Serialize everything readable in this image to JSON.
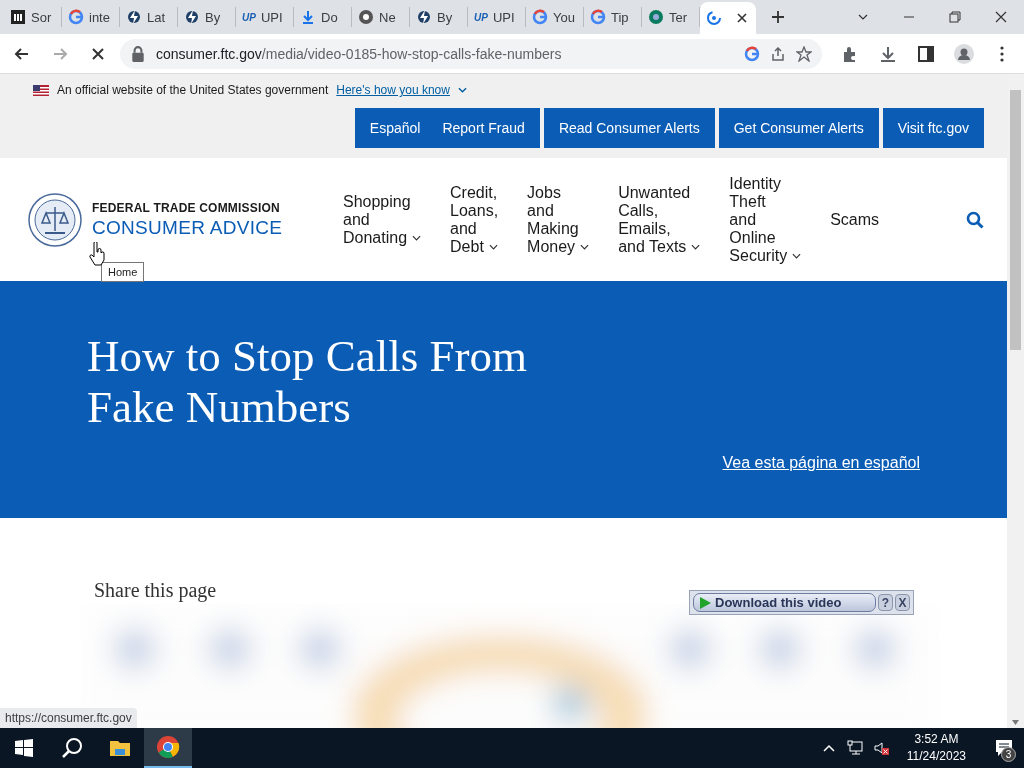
{
  "browser": {
    "tabs": [
      {
        "title": "Sor",
        "kind": "museum",
        "selected": false
      },
      {
        "title": "inte",
        "kind": "google",
        "selected": false
      },
      {
        "title": "Lat",
        "kind": "bolt",
        "selected": false
      },
      {
        "title": "By",
        "kind": "bolt",
        "selected": false
      },
      {
        "title": "UPI",
        "kind": "lettermark",
        "icon_text": "UP",
        "selected": false
      },
      {
        "title": "Do",
        "kind": "download",
        "selected": false
      },
      {
        "title": "Ne",
        "kind": "chrome",
        "selected": false
      },
      {
        "title": "By",
        "kind": "bolt",
        "selected": false
      },
      {
        "title": "UPI",
        "kind": "lettermark",
        "icon_text": "UP",
        "selected": false
      },
      {
        "title": "You",
        "kind": "google",
        "selected": false
      },
      {
        "title": "Tip",
        "kind": "google",
        "selected": false
      },
      {
        "title": "Ter",
        "kind": "globe",
        "selected": false
      },
      {
        "kind": "spinner",
        "selected": true
      }
    ],
    "address": {
      "domain": "consumer.ftc.gov",
      "path": "/media/video-0185-how-stop-calls-fake-numbers",
      "loading": true
    }
  },
  "gov_banner": {
    "text": "An official website of the United States government",
    "link": "Here's how you know"
  },
  "utility_nav": [
    {
      "items": [
        "Español",
        "Report Fraud"
      ]
    },
    {
      "items": [
        "Read Consumer Alerts"
      ]
    },
    {
      "items": [
        "Get Consumer Alerts"
      ]
    },
    {
      "items": [
        "Visit ftc.gov"
      ]
    }
  ],
  "logo": {
    "agency": "FEDERAL TRADE COMMISSION",
    "site": "CONSUMER ADVICE"
  },
  "main_nav": [
    {
      "label": "Shopping\nand\nDonating",
      "dropdown": true
    },
    {
      "label": "Credit,\nLoans,\nand\nDebt",
      "dropdown": true
    },
    {
      "label": "Jobs\nand\nMaking\nMoney",
      "dropdown": true
    },
    {
      "label": "Unwanted\nCalls,\nEmails,\nand Texts",
      "dropdown": true
    },
    {
      "label": "Identity\nTheft\nand\nOnline\nSecurity",
      "dropdown": true
    },
    {
      "label": "Scams",
      "dropdown": false
    }
  ],
  "tooltip": "Home",
  "hero": {
    "title": "How to Stop Calls From Fake Numbers",
    "spanish_link": "Vea esta página en español"
  },
  "share_heading": "Share this page",
  "download_bar": {
    "label": "Download this video",
    "help": "?",
    "close": "X"
  },
  "status_url": "https://consumer.ftc.gov",
  "taskbar": {
    "apps": [
      {
        "kind": "search",
        "selected": false
      },
      {
        "kind": "folder",
        "selected": false
      },
      {
        "kind": "chrome",
        "selected": true
      }
    ],
    "time": "3:52 AM",
    "date": "11/24/2023",
    "notifications": "3",
    "muted": true
  }
}
